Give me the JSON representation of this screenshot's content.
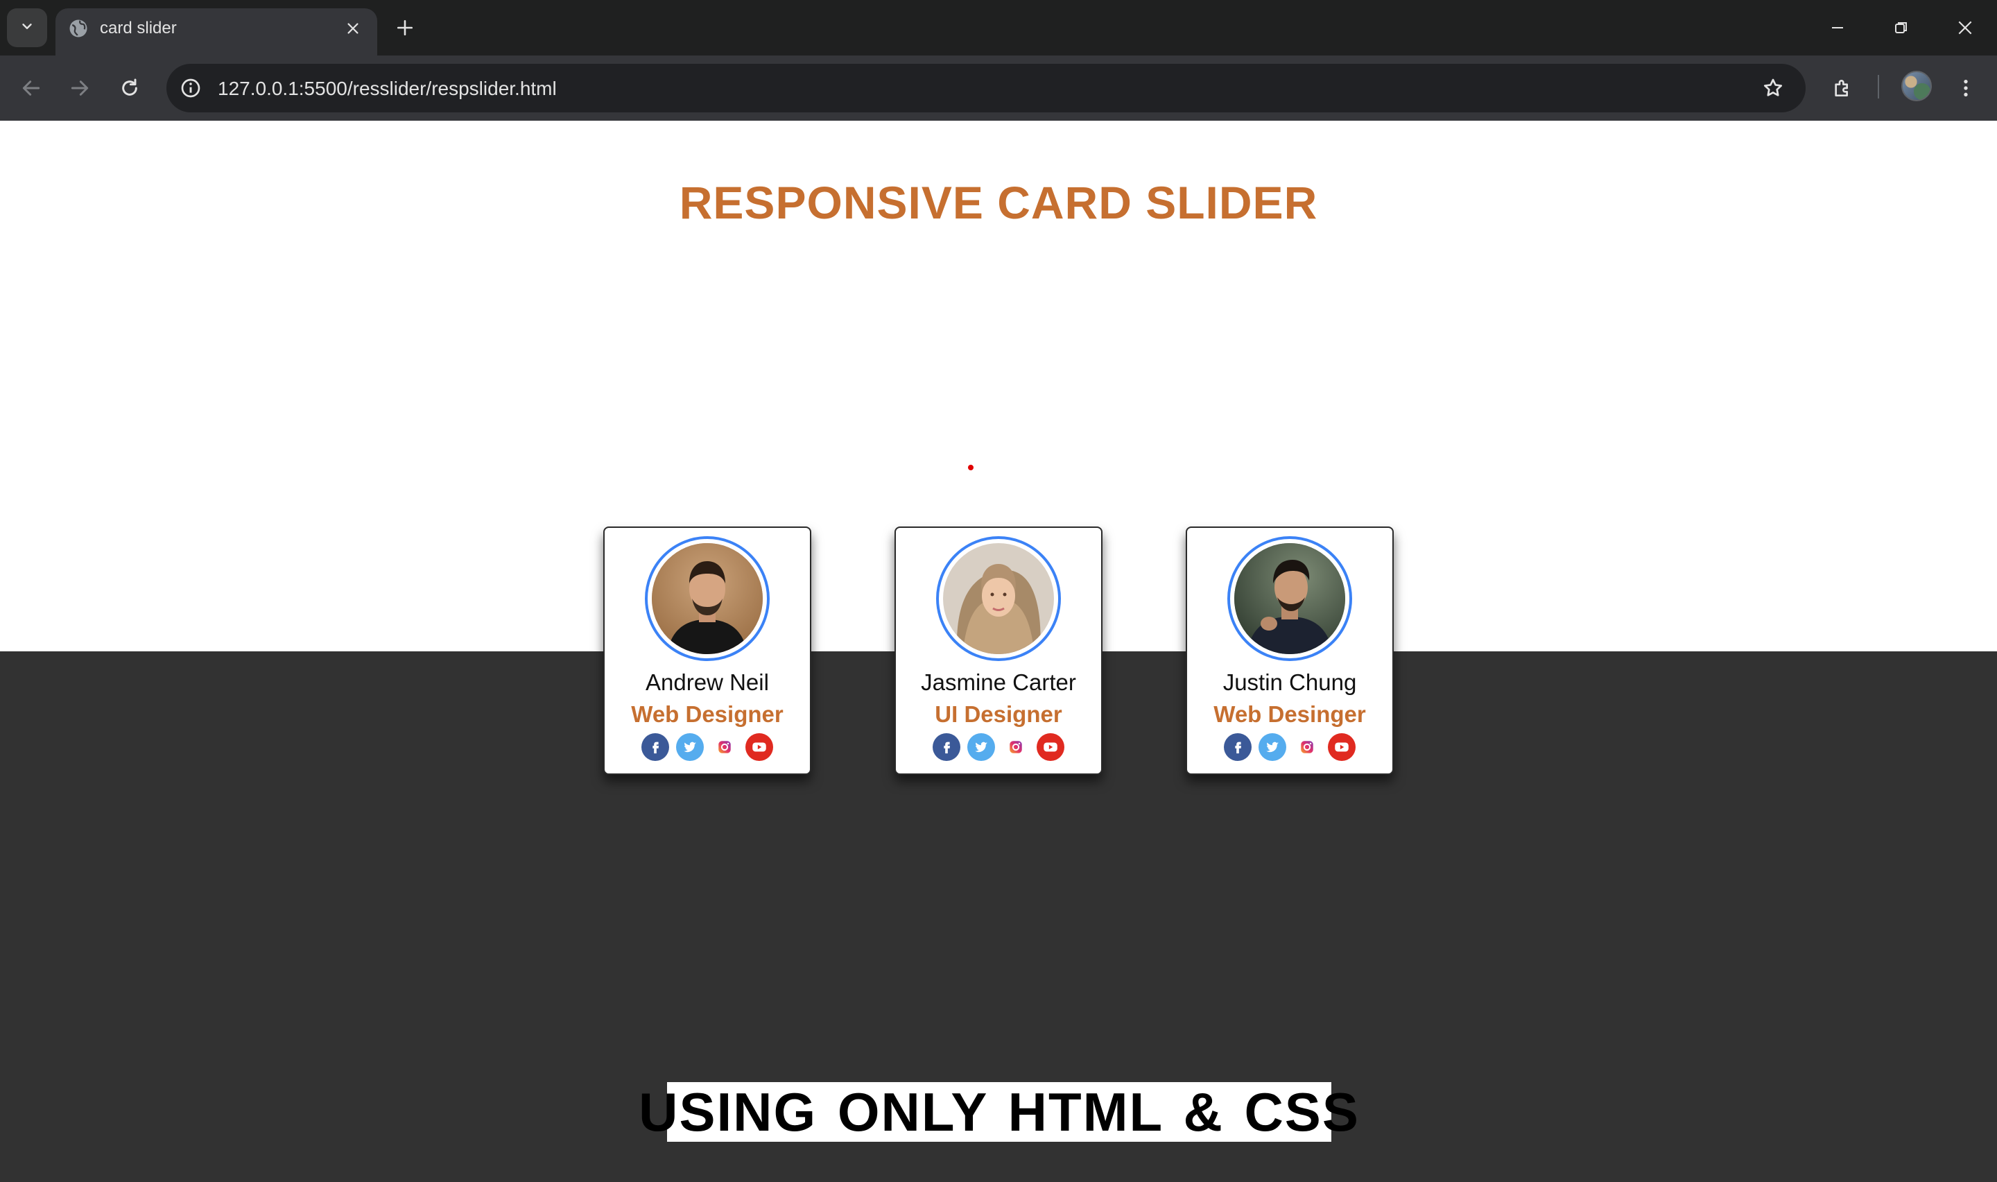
{
  "browser": {
    "tab_title": "card slider",
    "url": "127.0.0.1:5500/resslider/respslider.html",
    "icons": {
      "tab_search": "chevron-down-icon",
      "favicon": "globe-icon",
      "tab_close": "close-icon",
      "new_tab": "plus-icon",
      "minimize": "minimize-icon",
      "restore": "restore-icon",
      "close_window": "close-icon",
      "back": "arrow-left-icon",
      "forward": "arrow-right-icon",
      "reload": "reload-icon",
      "site_info": "info-icon",
      "bookmark": "star-icon",
      "extensions": "puzzle-icon",
      "profile": "avatar",
      "menu": "kebab-menu-icon"
    }
  },
  "page": {
    "heading": "RESPONSIVE CARD SLIDER",
    "bottom_text": "USING ONLY HTML & CSS",
    "colors": {
      "accent": "#c66f30",
      "avatar_ring": "#3b82f6",
      "dark_background": "#323232",
      "marker_dot": "#e00000"
    },
    "cards": [
      {
        "name": "Andrew Neil",
        "role": "Web Designer",
        "socials": [
          "facebook-icon",
          "twitter-icon",
          "instagram-icon",
          "youtube-icon"
        ]
      },
      {
        "name": "Jasmine Carter",
        "role": "UI Designer",
        "socials": [
          "facebook-icon",
          "twitter-icon",
          "instagram-icon",
          "youtube-icon"
        ]
      },
      {
        "name": "Justin Chung",
        "role": "Web Desinger",
        "socials": [
          "facebook-icon",
          "twitter-icon",
          "instagram-icon",
          "youtube-icon"
        ]
      }
    ]
  }
}
